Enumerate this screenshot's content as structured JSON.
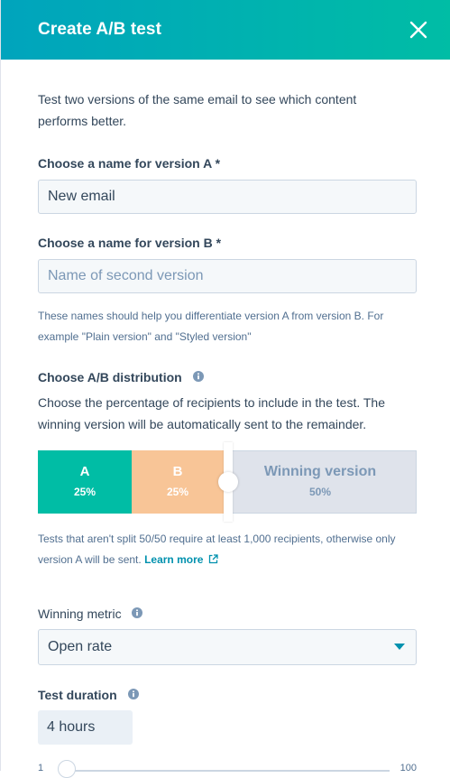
{
  "header": {
    "title": "Create A/B test"
  },
  "intro": "Test two versions of the same email to see which content performs better.",
  "versionA": {
    "label": "Choose a name for version A *",
    "value": "New email"
  },
  "versionB": {
    "label": "Choose a name for version B *",
    "placeholder": "Name of second version"
  },
  "names_help": "These names should help you differentiate version A from version B. For example \"Plain version\" and \"Styled version\"",
  "distribution": {
    "label": "Choose A/B distribution",
    "description": "Choose the percentage of recipients to include in the test. The winning version will be automatically sent to the remainder.",
    "segments": [
      {
        "name": "A",
        "percent": "25%"
      },
      {
        "name": "B",
        "percent": "25%"
      },
      {
        "name": "Winning version",
        "percent": "50%"
      }
    ],
    "help": "Tests that aren't split 50/50 require at least 1,000 recipients, otherwise only version A will be sent.",
    "learn_more": "Learn more"
  },
  "metric": {
    "label": "Winning metric",
    "value": "Open rate"
  },
  "duration": {
    "label": "Test duration",
    "value": "4 hours",
    "min": "1",
    "max": "100"
  },
  "colors": {
    "header_start": "#00a4bd",
    "header_end": "#00bda5",
    "segment_a": "#00bda5",
    "segment_b": "#f8c597",
    "link": "#0091ae"
  }
}
